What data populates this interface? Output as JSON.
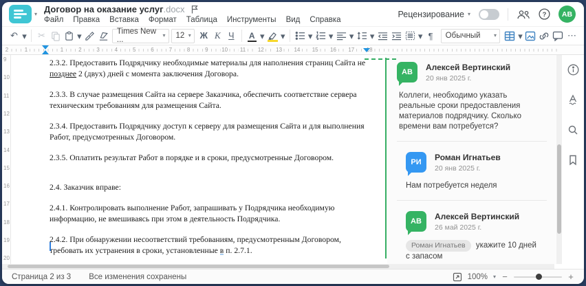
{
  "header": {
    "title": "Договор на оказание услуг",
    "title_ext": ".docx",
    "menu": [
      "Файл",
      "Правка",
      "Вставка",
      "Формат",
      "Таблица",
      "Инструменты",
      "Вид",
      "Справка"
    ],
    "review_label": "Рецензирование",
    "avatar_initials": "АВ"
  },
  "icons": {
    "undo": "↶",
    "cut": "✂",
    "caret": "▾",
    "pilcrow": "¶",
    "more": "⋯",
    "question": "?"
  },
  "toolbar": {
    "font_name": "Times New ...",
    "font_size": "12",
    "bold_label": "Ж",
    "italic_label": "К",
    "underline_label": "Ч",
    "font_color_label": "А",
    "style_name": "Обычный"
  },
  "ruler": {
    "left_numbers": [
      "2",
      "1"
    ],
    "numbers": [
      "1",
      "2",
      "3",
      "4",
      "5",
      "6",
      "7",
      "8",
      "9",
      "10",
      "11",
      "12",
      "13",
      "14",
      "15",
      "16",
      "17",
      "18"
    ],
    "vertical": [
      "9",
      "10",
      "11",
      "12",
      "13",
      "14",
      "15",
      "16",
      "17",
      "18",
      "19",
      "20"
    ]
  },
  "document": {
    "paragraphs": [
      {
        "segments": [
          {
            "text": "2.3.2. Предоставить Подрядчику необходимые материалы для наполнения страниц Сайта не "
          },
          {
            "text": "позднее",
            "style": "underline"
          },
          {
            "text": " 2 (двух) дней с момента заключения Договора."
          }
        ]
      },
      {
        "segments": [
          {
            "text": "2.3.3. В случае размещения Сайта на сервере Заказчика, обеспечить соответствие сервера техническим требованиям для размещения Сайта."
          }
        ]
      },
      {
        "segments": [
          {
            "text": "2.3.4. Предоставить Подрядчику доступ к серверу для размещения Сайта и для выполнения Работ, предусмотренных Договором."
          }
        ]
      },
      {
        "segments": [
          {
            "text": "2.3.5. Оплатить результат Работ в порядке и в сроки, предусмотренные Договором."
          }
        ]
      },
      {
        "gap": true,
        "segments": [
          {
            "text": "2.4. Заказчик вправе:"
          }
        ]
      },
      {
        "segments": [
          {
            "text": "2.4.1. Контролировать выполнение Работ, запрашивать у Подрядчика необходимую информацию, не вмешиваясь при этом в деятельность Подрядчика."
          }
        ]
      },
      {
        "segments": [
          {
            "text": "2.4.2. При обнаружении несоответствий требованиям, предусмотренным Договором, требовать их устранения в сроки, установленные "
          },
          {
            "text": "в",
            "style": "mark"
          },
          {
            "text": " п. 2.7.1."
          }
        ]
      }
    ]
  },
  "comments": {
    "thread": [
      {
        "initials": "АВ",
        "color": "green",
        "name": "Алексей Вертинский",
        "date": "20 янв 2025 г.",
        "text": "Коллеги, необходимо указать реальные сроки предоставления материалов подрядчику. Сколько времени вам потребуется?",
        "reply": false
      },
      {
        "initials": "РИ",
        "color": "blue",
        "name": "Роман Игнатьев",
        "date": "20 янв 2025 г.",
        "text": "Нам потребуется неделя",
        "reply": true
      },
      {
        "initials": "АВ",
        "color": "green",
        "name": "Алексей Вертинский",
        "date": "26 май 2025 г.",
        "mention": "Роман Игнатьев",
        "text": " укажите 10 дней с запасом",
        "reply": true
      }
    ]
  },
  "status": {
    "page_info": "Страница 2 из 3",
    "save_status": "Все изменения сохранены",
    "zoom_value": "100%"
  }
}
